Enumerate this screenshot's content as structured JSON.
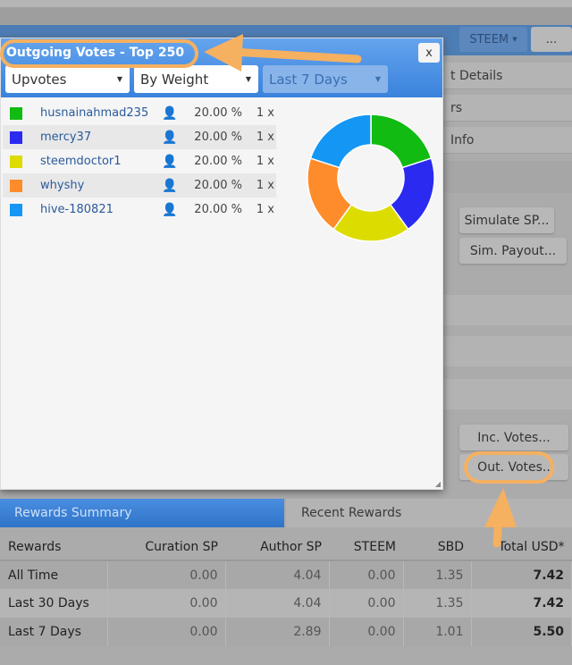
{
  "header": {
    "currency_label": "STEEM",
    "more_label": "..."
  },
  "right_panel": {
    "items": [
      "t Details",
      "rs",
      "Info"
    ],
    "buttons": {
      "simulate_sp": "Simulate SP...",
      "sim_payout": "Sim. Payout...",
      "inc_votes": "Inc. Votes...",
      "out_votes": "Out. Votes.."
    }
  },
  "dialog": {
    "title": "Outgoing Votes - Top 250",
    "close_label": "x",
    "filters": {
      "type": "Upvotes",
      "sort": "By Weight",
      "period": "Last 7 Days"
    },
    "votes": [
      {
        "name": "husnainahmad235",
        "percent": "20.00 %",
        "count": "1 x",
        "color": "#11bb11"
      },
      {
        "name": "mercy37",
        "percent": "20.00 %",
        "count": "1 x",
        "color": "#2a2af0"
      },
      {
        "name": "steemdoctor1",
        "percent": "20.00 %",
        "count": "1 x",
        "color": "#dcdc00"
      },
      {
        "name": "whyshy",
        "percent": "20.00 %",
        "count": "1 x",
        "color": "#ff8c2a"
      },
      {
        "name": "hive-180821",
        "percent": "20.00 %",
        "count": "1 x",
        "color": "#1496f5"
      }
    ]
  },
  "tabs": {
    "summary": "Rewards Summary",
    "recent": "Recent Rewards"
  },
  "rewards": {
    "headers": [
      "Rewards",
      "Curation SP",
      "Author SP",
      "STEEM",
      "SBD",
      "Total USD*"
    ],
    "rows": [
      [
        "All Time",
        "0.00",
        "4.04",
        "0.00",
        "1.35",
        "7.42"
      ],
      [
        "Last 30 Days",
        "0.00",
        "4.04",
        "0.00",
        "1.35",
        "7.42"
      ],
      [
        "Last 7 Days",
        "0.00",
        "2.89",
        "0.00",
        "1.01",
        "5.50"
      ]
    ]
  },
  "annotation_color": "#f5b060"
}
